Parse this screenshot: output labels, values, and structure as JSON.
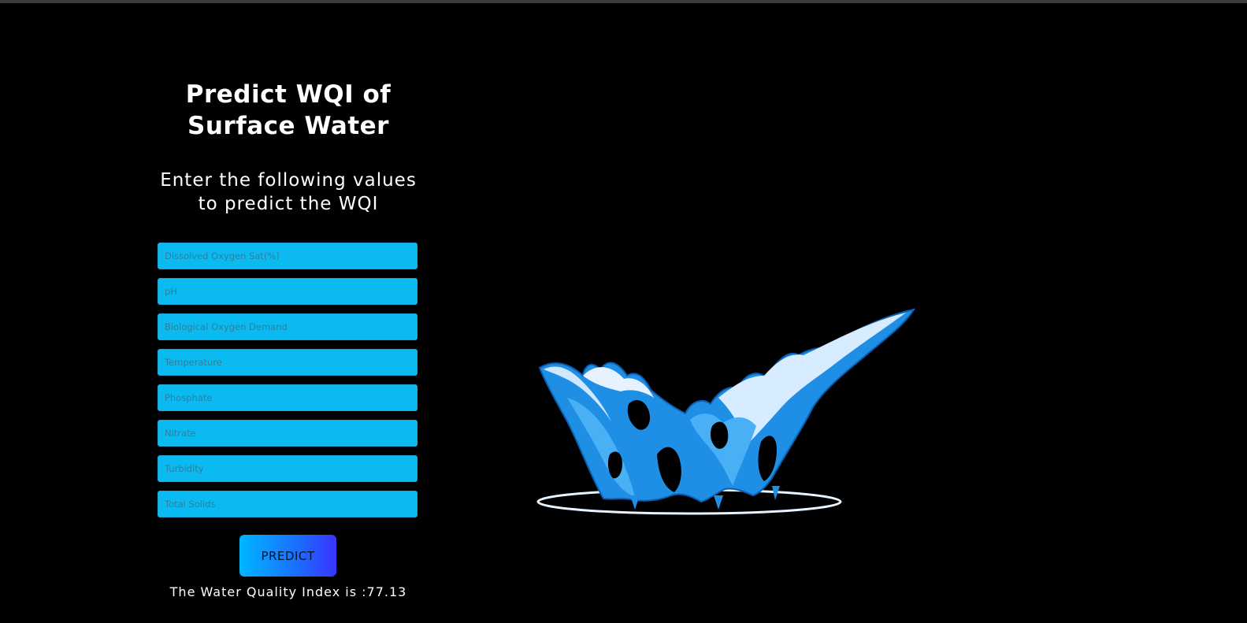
{
  "header": {
    "title_line1": "Predict WQI of",
    "title_line2": "Surface Water",
    "subtitle_line1": "Enter the following values",
    "subtitle_line2": "to predict the WQI"
  },
  "form": {
    "fields": [
      {
        "placeholder": "Dissolved Oxygen Sat(%)",
        "value": ""
      },
      {
        "placeholder": "pH",
        "value": ""
      },
      {
        "placeholder": "Biological Oxygen Demand",
        "value": ""
      },
      {
        "placeholder": "Temperature",
        "value": ""
      },
      {
        "placeholder": "Phosphate",
        "value": ""
      },
      {
        "placeholder": "Nitrate",
        "value": ""
      },
      {
        "placeholder": "Turbidity",
        "value": ""
      },
      {
        "placeholder": "Total Solids",
        "value": ""
      }
    ],
    "submit_label": "PREDICT"
  },
  "result": {
    "text": "The Water Quality Index is :77.13"
  },
  "illustration": {
    "icon": "water-splash-icon"
  },
  "colors": {
    "background": "#000000",
    "field_fill": "#0abaf0",
    "button_gradient_start": "#00b7ff",
    "button_gradient_end": "#3a35ff",
    "text": "#ffffff"
  }
}
